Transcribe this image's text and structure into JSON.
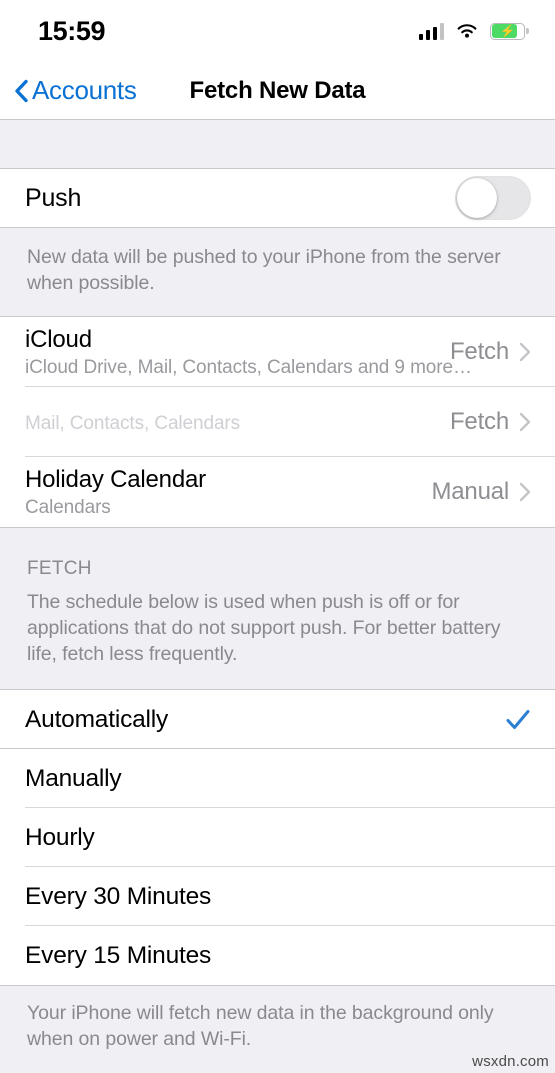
{
  "status_bar": {
    "time": "15:59",
    "signal_icon": "cellular-signal-icon",
    "signal_bars_filled": 3,
    "signal_bars_total": 4,
    "wifi_icon": "wifi-icon",
    "battery_icon": "battery-charging-icon",
    "battery_charging": true,
    "battery_percent": 75
  },
  "nav": {
    "back_label": "Accounts",
    "back_icon": "chevron-left-icon",
    "title": "Fetch New Data"
  },
  "push": {
    "label": "Push",
    "toggle_state": "off",
    "footnote": "New data will be pushed to your iPhone from the server when possible."
  },
  "accounts": [
    {
      "title": "iCloud",
      "subtitle": "iCloud Drive, Mail, Contacts, Calendars and 9 more…",
      "value": "Fetch",
      "redacted": false
    },
    {
      "title": "",
      "subtitle": "Mail, Contacts, Calendars",
      "value": "Fetch",
      "redacted": true
    },
    {
      "title": "Holiday Calendar",
      "subtitle": "Calendars",
      "value": "Manual",
      "redacted": false
    }
  ],
  "fetch_section": {
    "header": "FETCH",
    "description": "The schedule below is used when push is off or for applications that do not support push. For better battery life, fetch less frequently."
  },
  "fetch_options": [
    {
      "label": "Automatically",
      "selected": true
    },
    {
      "label": "Manually",
      "selected": false
    },
    {
      "label": "Hourly",
      "selected": false
    },
    {
      "label": "Every 30 Minutes",
      "selected": false
    },
    {
      "label": "Every 15 Minutes",
      "selected": false
    }
  ],
  "bottom_footnote": "Your iPhone will fetch new data in the background only when on power and Wi-Fi.",
  "watermark": "wsxdn.com",
  "colors": {
    "accent_blue": "#007AFF",
    "link_blue": "#0b72d4",
    "group_background": "#EFEFF4",
    "row_background": "#FFFFFF",
    "secondary_text": "#8E8E93",
    "battery_green": "#4CD964"
  }
}
